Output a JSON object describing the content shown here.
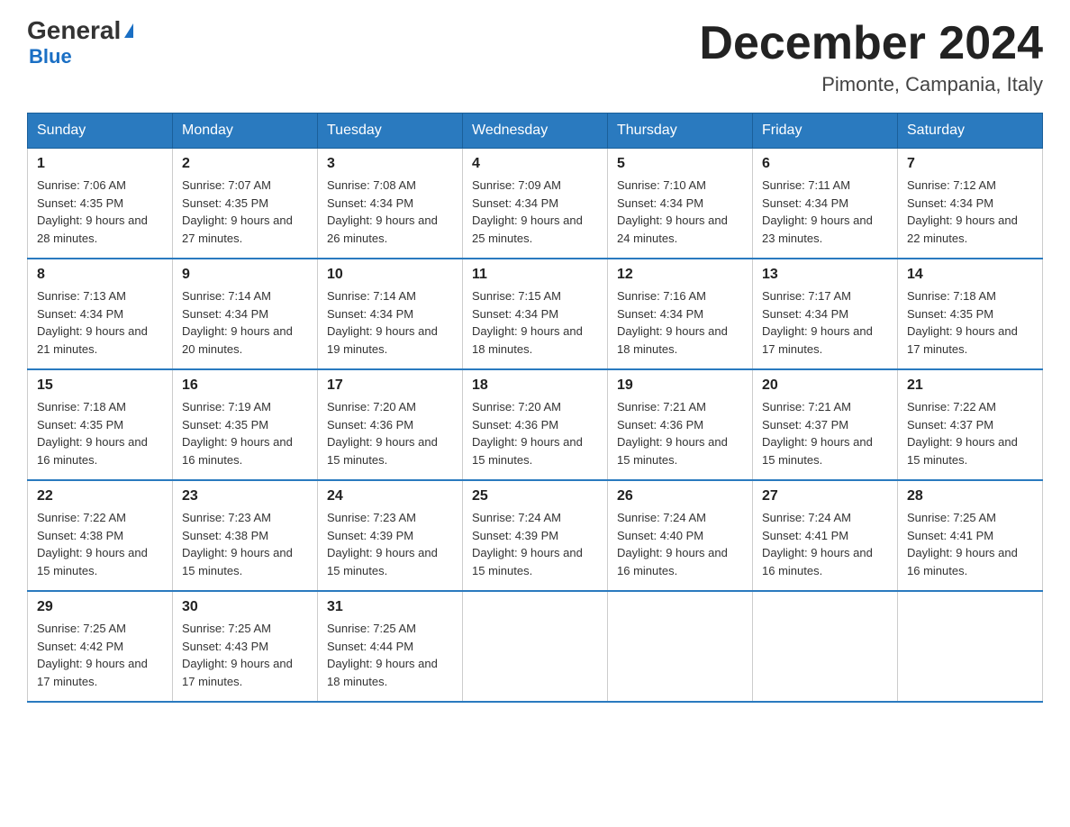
{
  "logo": {
    "general": "General",
    "triangle": "",
    "blue": "Blue"
  },
  "title": {
    "month_year": "December 2024",
    "location": "Pimonte, Campania, Italy"
  },
  "days_of_week": [
    "Sunday",
    "Monday",
    "Tuesday",
    "Wednesday",
    "Thursday",
    "Friday",
    "Saturday"
  ],
  "weeks": [
    [
      {
        "day": "1",
        "sunrise": "Sunrise: 7:06 AM",
        "sunset": "Sunset: 4:35 PM",
        "daylight": "Daylight: 9 hours and 28 minutes."
      },
      {
        "day": "2",
        "sunrise": "Sunrise: 7:07 AM",
        "sunset": "Sunset: 4:35 PM",
        "daylight": "Daylight: 9 hours and 27 minutes."
      },
      {
        "day": "3",
        "sunrise": "Sunrise: 7:08 AM",
        "sunset": "Sunset: 4:34 PM",
        "daylight": "Daylight: 9 hours and 26 minutes."
      },
      {
        "day": "4",
        "sunrise": "Sunrise: 7:09 AM",
        "sunset": "Sunset: 4:34 PM",
        "daylight": "Daylight: 9 hours and 25 minutes."
      },
      {
        "day": "5",
        "sunrise": "Sunrise: 7:10 AM",
        "sunset": "Sunset: 4:34 PM",
        "daylight": "Daylight: 9 hours and 24 minutes."
      },
      {
        "day": "6",
        "sunrise": "Sunrise: 7:11 AM",
        "sunset": "Sunset: 4:34 PM",
        "daylight": "Daylight: 9 hours and 23 minutes."
      },
      {
        "day": "7",
        "sunrise": "Sunrise: 7:12 AM",
        "sunset": "Sunset: 4:34 PM",
        "daylight": "Daylight: 9 hours and 22 minutes."
      }
    ],
    [
      {
        "day": "8",
        "sunrise": "Sunrise: 7:13 AM",
        "sunset": "Sunset: 4:34 PM",
        "daylight": "Daylight: 9 hours and 21 minutes."
      },
      {
        "day": "9",
        "sunrise": "Sunrise: 7:14 AM",
        "sunset": "Sunset: 4:34 PM",
        "daylight": "Daylight: 9 hours and 20 minutes."
      },
      {
        "day": "10",
        "sunrise": "Sunrise: 7:14 AM",
        "sunset": "Sunset: 4:34 PM",
        "daylight": "Daylight: 9 hours and 19 minutes."
      },
      {
        "day": "11",
        "sunrise": "Sunrise: 7:15 AM",
        "sunset": "Sunset: 4:34 PM",
        "daylight": "Daylight: 9 hours and 18 minutes."
      },
      {
        "day": "12",
        "sunrise": "Sunrise: 7:16 AM",
        "sunset": "Sunset: 4:34 PM",
        "daylight": "Daylight: 9 hours and 18 minutes."
      },
      {
        "day": "13",
        "sunrise": "Sunrise: 7:17 AM",
        "sunset": "Sunset: 4:34 PM",
        "daylight": "Daylight: 9 hours and 17 minutes."
      },
      {
        "day": "14",
        "sunrise": "Sunrise: 7:18 AM",
        "sunset": "Sunset: 4:35 PM",
        "daylight": "Daylight: 9 hours and 17 minutes."
      }
    ],
    [
      {
        "day": "15",
        "sunrise": "Sunrise: 7:18 AM",
        "sunset": "Sunset: 4:35 PM",
        "daylight": "Daylight: 9 hours and 16 minutes."
      },
      {
        "day": "16",
        "sunrise": "Sunrise: 7:19 AM",
        "sunset": "Sunset: 4:35 PM",
        "daylight": "Daylight: 9 hours and 16 minutes."
      },
      {
        "day": "17",
        "sunrise": "Sunrise: 7:20 AM",
        "sunset": "Sunset: 4:36 PM",
        "daylight": "Daylight: 9 hours and 15 minutes."
      },
      {
        "day": "18",
        "sunrise": "Sunrise: 7:20 AM",
        "sunset": "Sunset: 4:36 PM",
        "daylight": "Daylight: 9 hours and 15 minutes."
      },
      {
        "day": "19",
        "sunrise": "Sunrise: 7:21 AM",
        "sunset": "Sunset: 4:36 PM",
        "daylight": "Daylight: 9 hours and 15 minutes."
      },
      {
        "day": "20",
        "sunrise": "Sunrise: 7:21 AM",
        "sunset": "Sunset: 4:37 PM",
        "daylight": "Daylight: 9 hours and 15 minutes."
      },
      {
        "day": "21",
        "sunrise": "Sunrise: 7:22 AM",
        "sunset": "Sunset: 4:37 PM",
        "daylight": "Daylight: 9 hours and 15 minutes."
      }
    ],
    [
      {
        "day": "22",
        "sunrise": "Sunrise: 7:22 AM",
        "sunset": "Sunset: 4:38 PM",
        "daylight": "Daylight: 9 hours and 15 minutes."
      },
      {
        "day": "23",
        "sunrise": "Sunrise: 7:23 AM",
        "sunset": "Sunset: 4:38 PM",
        "daylight": "Daylight: 9 hours and 15 minutes."
      },
      {
        "day": "24",
        "sunrise": "Sunrise: 7:23 AM",
        "sunset": "Sunset: 4:39 PM",
        "daylight": "Daylight: 9 hours and 15 minutes."
      },
      {
        "day": "25",
        "sunrise": "Sunrise: 7:24 AM",
        "sunset": "Sunset: 4:39 PM",
        "daylight": "Daylight: 9 hours and 15 minutes."
      },
      {
        "day": "26",
        "sunrise": "Sunrise: 7:24 AM",
        "sunset": "Sunset: 4:40 PM",
        "daylight": "Daylight: 9 hours and 16 minutes."
      },
      {
        "day": "27",
        "sunrise": "Sunrise: 7:24 AM",
        "sunset": "Sunset: 4:41 PM",
        "daylight": "Daylight: 9 hours and 16 minutes."
      },
      {
        "day": "28",
        "sunrise": "Sunrise: 7:25 AM",
        "sunset": "Sunset: 4:41 PM",
        "daylight": "Daylight: 9 hours and 16 minutes."
      }
    ],
    [
      {
        "day": "29",
        "sunrise": "Sunrise: 7:25 AM",
        "sunset": "Sunset: 4:42 PM",
        "daylight": "Daylight: 9 hours and 17 minutes."
      },
      {
        "day": "30",
        "sunrise": "Sunrise: 7:25 AM",
        "sunset": "Sunset: 4:43 PM",
        "daylight": "Daylight: 9 hours and 17 minutes."
      },
      {
        "day": "31",
        "sunrise": "Sunrise: 7:25 AM",
        "sunset": "Sunset: 4:44 PM",
        "daylight": "Daylight: 9 hours and 18 minutes."
      },
      null,
      null,
      null,
      null
    ]
  ]
}
